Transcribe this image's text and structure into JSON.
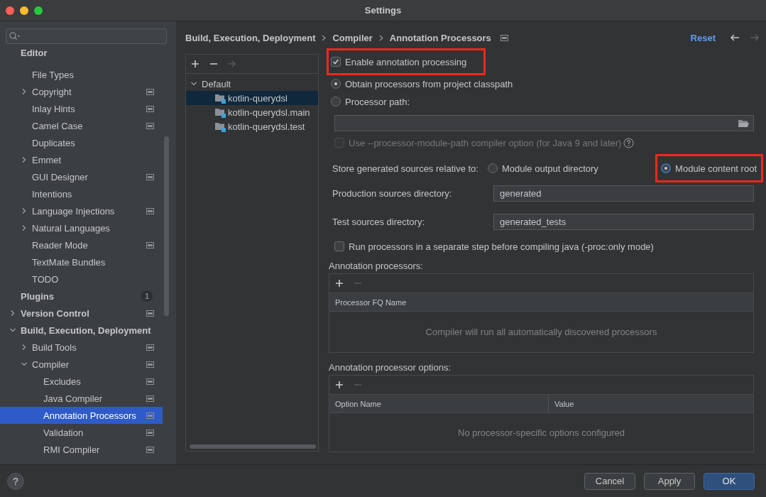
{
  "window": {
    "title": "Settings"
  },
  "sidebar": {
    "items": [
      {
        "label": "Editor",
        "kind": "header",
        "children": [
          {
            "label": "File Types",
            "settings_icon": false,
            "selected": false
          },
          {
            "label": "Copyright",
            "expanded": false,
            "settings_icon": true,
            "selected": false
          },
          {
            "label": "Inlay Hints",
            "settings_icon": true,
            "selected": false
          },
          {
            "label": "Camel Case",
            "settings_icon": true,
            "selected": false
          },
          {
            "label": "Duplicates",
            "settings_icon": false,
            "selected": false
          },
          {
            "label": "Emmet",
            "expanded": false,
            "settings_icon": false,
            "selected": false
          },
          {
            "label": "GUI Designer",
            "settings_icon": true,
            "selected": false
          },
          {
            "label": "Intentions",
            "settings_icon": false,
            "selected": false
          },
          {
            "label": "Language Injections",
            "expanded": false,
            "settings_icon": true,
            "selected": false
          },
          {
            "label": "Natural Languages",
            "expanded": false,
            "settings_icon": false,
            "selected": false
          },
          {
            "label": "Reader Mode",
            "settings_icon": true,
            "selected": false
          },
          {
            "label": "TextMate Bundles",
            "settings_icon": false,
            "selected": false
          },
          {
            "label": "TODO",
            "settings_icon": false,
            "selected": false
          }
        ]
      },
      {
        "label": "Plugins",
        "badge": "1",
        "settings_icon": false,
        "selected": false
      },
      {
        "label": "Version Control",
        "expanded": false,
        "settings_icon": true,
        "selected": false
      },
      {
        "label": "Build, Execution, Deployment",
        "expanded": true,
        "settings_icon": false,
        "selected": false,
        "children": [
          {
            "label": "Build Tools",
            "expanded": false,
            "settings_icon": true,
            "selected": false
          },
          {
            "label": "Compiler",
            "expanded": true,
            "settings_icon": true,
            "selected": false,
            "children": [
              {
                "label": "Excludes",
                "settings_icon": true,
                "selected": false
              },
              {
                "label": "Java Compiler",
                "settings_icon": true,
                "selected": false
              },
              {
                "label": "Annotation Processors",
                "settings_icon": true,
                "selected": true
              },
              {
                "label": "Validation",
                "settings_icon": true,
                "selected": false
              },
              {
                "label": "RMI Compiler",
                "settings_icon": true,
                "selected": false
              }
            ]
          }
        ]
      }
    ]
  },
  "breadcrumbs": [
    "Build, Execution, Deployment",
    "Compiler",
    "Annotation Processors"
  ],
  "reset": "Reset",
  "navigation": [
    {
      "kind": "back",
      "disabled": false
    },
    {
      "kind": "forward",
      "disabled": true
    }
  ],
  "profiles": {
    "toolbar": [
      {
        "kind": "add",
        "disabled": false
      },
      {
        "kind": "remove",
        "disabled": false
      },
      {
        "kind": "move",
        "disabled": true
      }
    ],
    "items": [
      {
        "label": "Default",
        "expanded": true,
        "children": [
          {
            "label": "kotlin-querydsl",
            "selected": true
          },
          {
            "label": "kotlin-querydsl.main",
            "selected": false
          },
          {
            "label": "kotlin-querydsl.test",
            "selected": false
          }
        ]
      }
    ]
  },
  "form": {
    "enable": {
      "label": "Enable annotation processing",
      "checked": true,
      "highlighted": true
    },
    "source_options": [
      {
        "label": "Obtain processors from project classpath",
        "selected": true
      },
      {
        "label": "Processor path:",
        "selected": false
      }
    ],
    "module_path_option": {
      "label": "Use --processor-module-path compiler option (for Java 9 and later)",
      "checked": false,
      "disabled": true
    },
    "store_label": "Store generated sources relative to:",
    "store_options": [
      {
        "label": "Module output directory",
        "selected": false,
        "highlighted": false
      },
      {
        "label": "Module content root",
        "selected": true,
        "highlighted": true
      }
    ],
    "production_dir": {
      "label": "Production sources directory:",
      "value": "generated"
    },
    "test_dir": {
      "label": "Test sources directory:",
      "value": "generated_tests"
    },
    "separate_step": {
      "label": "Run processors in a separate step before compiling java (-proc:only mode)",
      "checked": false
    },
    "processors_table": {
      "title": "Annotation processors:",
      "toolbar": [
        {
          "kind": "add",
          "disabled": false
        },
        {
          "kind": "remove",
          "disabled": true
        }
      ],
      "columns": [
        "Processor FQ Name"
      ],
      "empty_text": "Compiler will run all automatically discovered processors"
    },
    "options_table": {
      "title": "Annotation processor options:",
      "toolbar": [
        {
          "kind": "add",
          "disabled": false
        },
        {
          "kind": "remove",
          "disabled": true
        }
      ],
      "columns": [
        "Option Name",
        "Value"
      ],
      "empty_text": "No processor-specific options configured"
    }
  },
  "help_button": "?",
  "buttons": [
    {
      "label": "Cancel",
      "kind": "normal"
    },
    {
      "label": "Apply",
      "kind": "normal"
    },
    {
      "label": "OK",
      "kind": "default"
    }
  ]
}
